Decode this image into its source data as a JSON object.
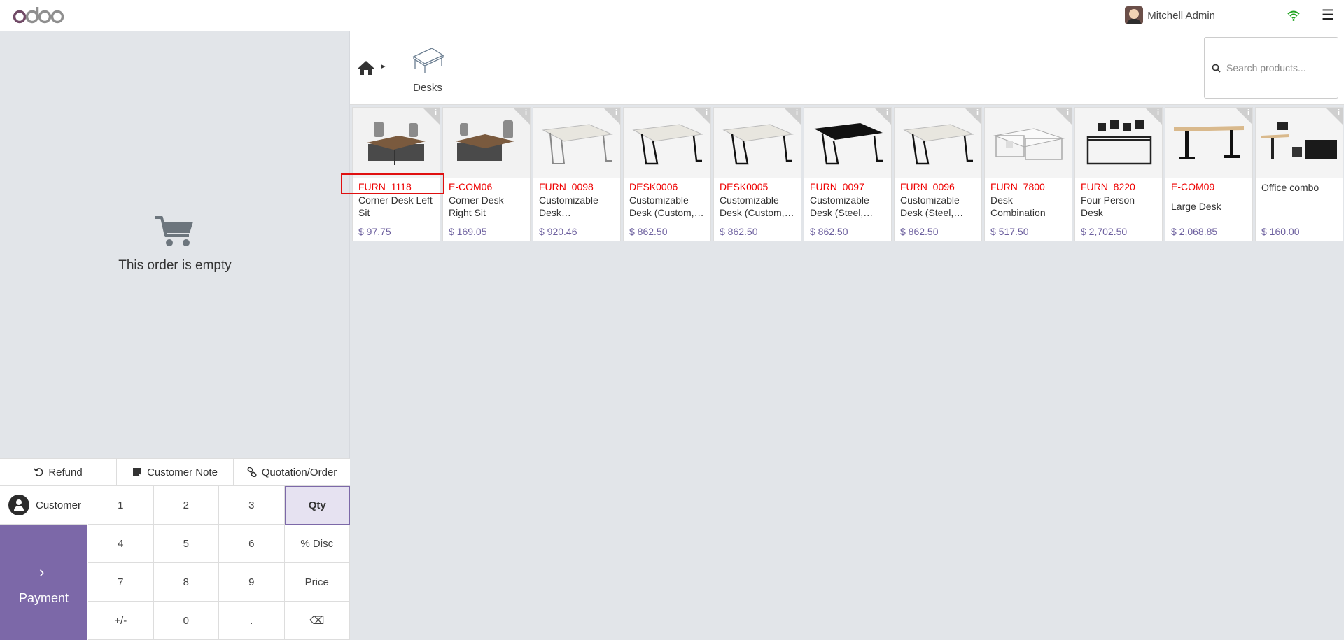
{
  "navbar": {
    "brand": "odoo",
    "user_name": "Mitchell Admin",
    "menu_icon": "hamburger-icon",
    "status_icon": "wifi-icon",
    "status_color": "#23a523"
  },
  "order": {
    "empty_text": "This order is empty"
  },
  "controls": {
    "refund": "Refund",
    "customer_note": "Customer Note",
    "quotation_order": "Quotation/Order"
  },
  "pad": {
    "customer_label": "Customer",
    "payment_label": "Payment",
    "keys": [
      "1",
      "2",
      "3",
      "Qty",
      "4",
      "5",
      "6",
      "% Disc",
      "7",
      "8",
      "9",
      "Price",
      "+/-",
      "0",
      ".",
      "⌫"
    ],
    "active_mode": "Qty"
  },
  "breadcrumb": {
    "category": "Desks"
  },
  "search": {
    "placeholder": "Search products..."
  },
  "colors": {
    "accent": "#7c68a8",
    "code_red": "#e00000",
    "price": "#6c5f9e"
  },
  "products": [
    {
      "code": "FURN_1118",
      "name": "Corner Desk Left Sit",
      "price": "$ 97.75",
      "image": "corner-desk-left"
    },
    {
      "code": "E-COM06",
      "name": "Corner Desk Right Sit",
      "price": "$ 169.05",
      "image": "corner-desk-right"
    },
    {
      "code": "FURN_0098",
      "name": "Customizable Desk…",
      "price": "$ 920.46",
      "image": "desk-white-grey"
    },
    {
      "code": "DESK0006",
      "name": "Customizable Desk (Custom,…",
      "price": "$ 862.50",
      "image": "desk-white-black"
    },
    {
      "code": "DESK0005",
      "name": "Customizable Desk (Custom,…",
      "price": "$ 862.50",
      "image": "desk-white-black"
    },
    {
      "code": "FURN_0097",
      "name": "Customizable Desk (Steel,…",
      "price": "$ 862.50",
      "image": "desk-black"
    },
    {
      "code": "FURN_0096",
      "name": "Customizable Desk (Steel,…",
      "price": "$ 862.50",
      "image": "desk-white-black"
    },
    {
      "code": "FURN_7800",
      "name": "Desk Combination",
      "price": "$ 517.50",
      "image": "desk-combination"
    },
    {
      "code": "FURN_8220",
      "name": "Four Person Desk",
      "price": "$ 2,702.50",
      "image": "four-person-desk"
    },
    {
      "code": "E-COM09",
      "name": "Large Desk",
      "price": "$ 2,068.85",
      "image": "large-desk"
    },
    {
      "code": "",
      "name": "Office combo",
      "price": "$ 160.00",
      "image": "office-combo"
    }
  ]
}
